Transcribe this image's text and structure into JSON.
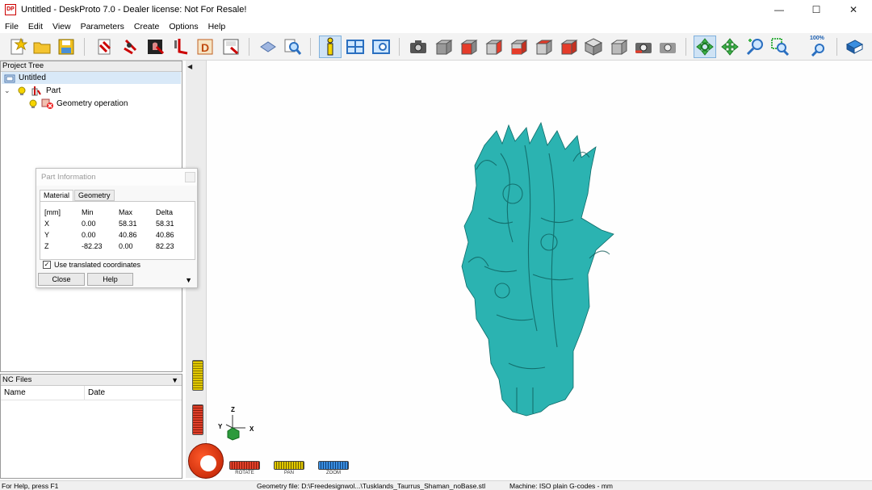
{
  "window": {
    "title": "Untitled - DeskProto 7.0 - Dealer license: Not For Resale!",
    "logo_text": "DP",
    "controls": [
      "—",
      "☐",
      "✕"
    ]
  },
  "menu": [
    "File",
    "Edit",
    "View",
    "Parameters",
    "Create",
    "Options",
    "Help"
  ],
  "toolbar": {
    "buttons": [
      "new-project",
      "open-project",
      "save-project",
      "import-geometry",
      "import-vector",
      "import-bitmap",
      "part-import",
      "drawing",
      "save-nc",
      "load-3d",
      "magnify-preview",
      "part-information",
      "part-parameters",
      "operation-parameters",
      "snapshot",
      "view-front",
      "view-back",
      "view-left",
      "view-right",
      "view-top",
      "view-bottom",
      "view-iso",
      "view-iso2",
      "view-reset",
      "view-fit",
      "rotate-view",
      "pan-view",
      "zoom-window",
      "zoom-box",
      "zoom-100",
      "help-book"
    ],
    "zoom_label": "100%"
  },
  "project_tree": {
    "header": "Project Tree",
    "root": "Untitled",
    "part": "Part",
    "operation": "Geometry operation"
  },
  "nc_files": {
    "header": "NC Files",
    "col_name": "Name",
    "col_date": "Date"
  },
  "part_info": {
    "title": "Part Information",
    "tabs": [
      "Material",
      "Geometry"
    ],
    "headers": [
      "[mm]",
      "Min",
      "Max",
      "Delta"
    ],
    "rows": [
      {
        "axis": "X",
        "min": "0.00",
        "max": "58.31",
        "delta": "58.31"
      },
      {
        "axis": "Y",
        "min": "0.00",
        "max": "40.86",
        "delta": "40.86"
      },
      {
        "axis": "Z",
        "min": "-82.23",
        "max": "0.00",
        "delta": "82.23"
      }
    ],
    "checkbox_label": "Use translated coordinates",
    "checkbox_checked": true,
    "close_label": "Close",
    "help_label": "Help"
  },
  "navigation": {
    "rotate_label": "ROTATE",
    "pan_label": "PAN",
    "zoom_label": "ZOOM"
  },
  "axes": {
    "z": "Z",
    "y": "Y",
    "x": "X"
  },
  "model": {
    "color": "#2bb3b1"
  },
  "status": {
    "help": "For Help, press F1",
    "geometry": "Geometry file: D:\\Freedesignwol...\\Tusklands_Taurrus_Shaman_noBase.stl",
    "machine": "Machine: ISO plain G-codes - mm"
  }
}
